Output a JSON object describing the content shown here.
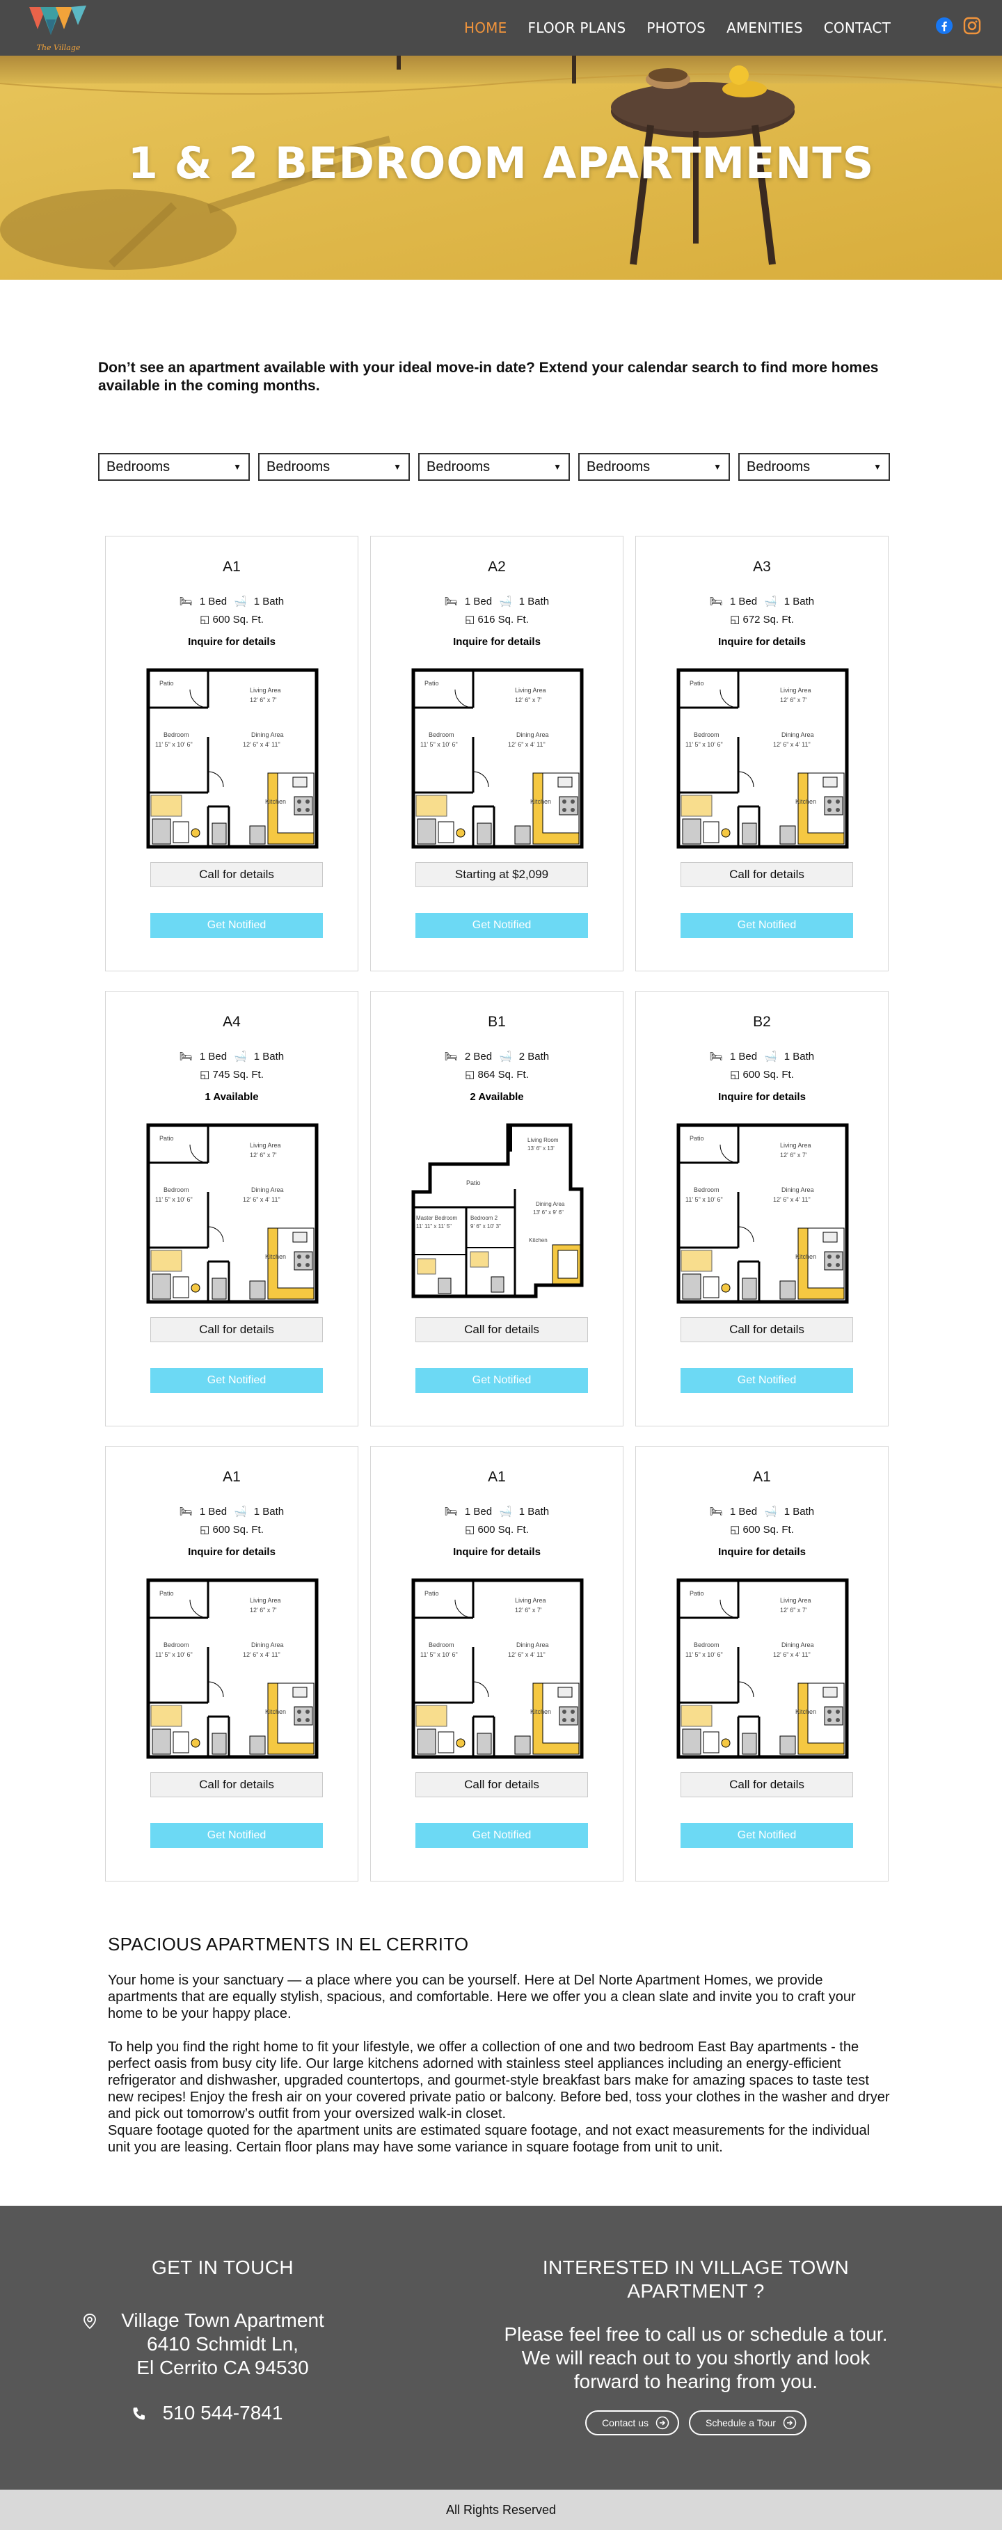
{
  "nav": {
    "logo_text": "The Village",
    "items": [
      {
        "label": "HOME",
        "active": true
      },
      {
        "label": "FLOOR PLANS",
        "active": false
      },
      {
        "label": "PHOTOS",
        "active": false
      },
      {
        "label": "AMENITIES",
        "active": false
      },
      {
        "label": "CONTACT",
        "active": false
      }
    ],
    "social": [
      "facebook-icon",
      "instagram-icon"
    ],
    "accent": "#f0943c",
    "bg": "#4a4a4a"
  },
  "hero": {
    "title": "1 & 2 BEDROOM APARTMENTS"
  },
  "notice": "Don’t see an apartment available with your ideal move-in date? Extend your calendar search to find more homes available in the coming months.",
  "filters": [
    "Bedrooms",
    "Bedrooms",
    "Bedrooms",
    "Bedrooms",
    "Bedrooms"
  ],
  "cards": [
    {
      "name": "A1",
      "beds": "1 Bed",
      "baths": "1 Bath",
      "sqft": "600 Sq. Ft.",
      "availability": "Inquire for details",
      "price": "Call for details",
      "cta": "Get Notified",
      "plan": "one-bed"
    },
    {
      "name": "A2",
      "beds": "1 Bed",
      "baths": "1 Bath",
      "sqft": "616 Sq. Ft.",
      "availability": "Inquire for details",
      "price": "Starting at $2,099",
      "cta": "Get Notified",
      "plan": "one-bed"
    },
    {
      "name": "A3",
      "beds": "1 Bed",
      "baths": "1 Bath",
      "sqft": "672 Sq. Ft.",
      "availability": "Inquire for details",
      "price": "Call for details",
      "cta": "Get Notified",
      "plan": "one-bed"
    },
    {
      "name": "A4",
      "beds": "1 Bed",
      "baths": "1 Bath",
      "sqft": "745 Sq. Ft.",
      "availability": "1 Available",
      "price": "Call for details",
      "cta": "Get Notified",
      "plan": "one-bed"
    },
    {
      "name": "B1",
      "beds": "2 Bed",
      "baths": "2 Bath",
      "sqft": "864 Sq. Ft.",
      "availability": "2 Available",
      "price": "Call for details",
      "cta": "Get Notified",
      "plan": "two-bed"
    },
    {
      "name": "B2",
      "beds": "1 Bed",
      "baths": "1 Bath",
      "sqft": "600 Sq. Ft.",
      "availability": "Inquire for details",
      "price": "Call for details",
      "cta": "Get Notified",
      "plan": "one-bed"
    },
    {
      "name": "A1",
      "beds": "1 Bed",
      "baths": "1 Bath",
      "sqft": "600 Sq. Ft.",
      "availability": "Inquire for details",
      "price": "Call for details",
      "cta": "Get Notified",
      "plan": "one-bed"
    },
    {
      "name": "A1",
      "beds": "1 Bed",
      "baths": "1 Bath",
      "sqft": "600 Sq. Ft.",
      "availability": "Inquire for details",
      "price": "Call for details",
      "cta": "Get Notified",
      "plan": "one-bed"
    },
    {
      "name": "A1",
      "beds": "1 Bed",
      "baths": "1 Bath",
      "sqft": "600 Sq. Ft.",
      "availability": "Inquire for details",
      "price": "Call for details",
      "cta": "Get Notified",
      "plan": "one-bed"
    }
  ],
  "plan_labels": {
    "one_bed": {
      "patio": "Patio",
      "living": "Living Area",
      "living_dim": "12' 6\" x 7'",
      "bedroom": "Bedroom",
      "bedroom_dim": "11' 5\" x 10' 6\"",
      "dining": "Dining Area",
      "dining_dim": "12' 6\" x 4' 11\"",
      "kitchen": "Kitchen"
    },
    "two_bed": {
      "patio": "Patio",
      "living": "Living Room",
      "living_dim": "13' 6\" x 13'",
      "master": "Master Bedroom",
      "master_dim": "11' 11\" x 11' 5\"",
      "bedroom2": "Bedroom 2",
      "bedroom2_dim": "9' 6\" x 10' 3\"",
      "dining": "Dining Area",
      "dining_dim": "13' 6\" x 9' 6\"",
      "kitchen": "Kitchen"
    }
  },
  "about": {
    "heading": "SPACIOUS APARTMENTS IN EL CERRITO",
    "p1": "Your home is your sanctuary — a place where you can be yourself. Here at Del Norte Apartment Homes, we provide apartments that are equally stylish, spacious, and comfortable. Here we offer you a clean slate and invite you to craft your home to be your happy place.",
    "p2": "To help you find the right home to fit your lifestyle, we offer a collection of one and two bedroom East Bay apartments - the perfect oasis from busy city life. Our large kitchens adorned with stainless steel appliances including an energy-efficient refrigerator and dishwasher, upgraded countertops, and gourmet-style breakfast bars make for amazing spaces to taste test new recipes! Enjoy the fresh air on your covered private patio or balcony. Before bed, toss your clothes in the washer and dryer and pick out tomorrow’s outfit from your oversized walk-in closet.",
    "p3": "Square footage quoted for the apartment units are estimated square footage, and not exact measurements for the individual unit you are leasing. Certain floor plans may have some variance in square footage from unit to unit."
  },
  "footer": {
    "touch_heading": "GET IN TOUCH",
    "address_line1": "Village Town Apartment",
    "address_line2": "6410 Schmidt Ln,",
    "address_line3": "El Cerrito CA 94530",
    "phone": "510 544-7841",
    "interested_heading": "INTERESTED IN VILLAGE TOWN APARTMENT ?",
    "interested_text": "Please feel free to call us or schedule a tour. We will reach out to you shortly and look forward to hearing from you.",
    "contact_btn": "Contact us",
    "tour_btn": "Schedule a Tour"
  },
  "copyright": "All Rights Reserved",
  "colors": {
    "notify": "#6cd9f4",
    "footer_bg": "#575757",
    "bottom_bg": "#d9d9d9",
    "kitchen": "#f5c842"
  }
}
